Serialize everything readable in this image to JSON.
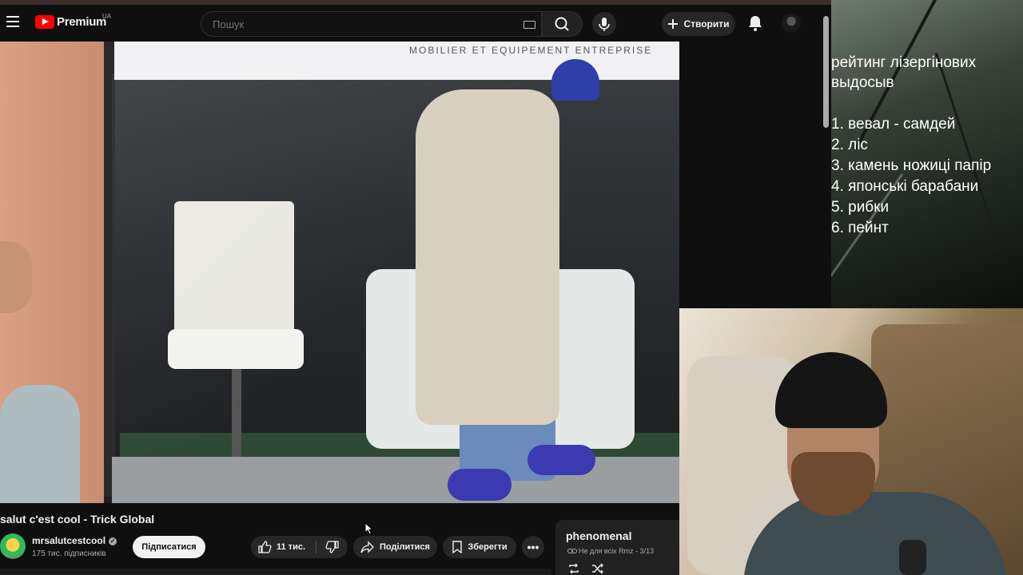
{
  "header": {
    "logo_text": "Premium",
    "logo_region": "UA",
    "search_placeholder": "Пошук",
    "create_label": "Створити",
    "icons": [
      "menu-icon",
      "youtube-logo-icon",
      "keyboard-icon",
      "search-icon",
      "mic-icon",
      "plus-icon",
      "bell-icon"
    ]
  },
  "video": {
    "store_sign": "MOBILIER ET EQUIPEMENT ENTREPRISE"
  },
  "meta": {
    "title": "salut c'est cool - Trick Global",
    "channel_name": "mrsalutcestcool",
    "subscribers": "175 тис. підписників",
    "subscribe_label": "Підписатися",
    "likes": "11 тис.",
    "share_label": "Поділитися",
    "save_label": "Зберегти",
    "more_label": "•••"
  },
  "playlist": {
    "title": "phenomenal",
    "meta": "Не для всіх  Rmz - 3/13"
  },
  "overlay": {
    "heading": "рейтинг лізергінових\nвыдосыв",
    "items": [
      "1. вевал - самдей",
      "2. ліс",
      "3. камень ножиці папір",
      "4. японські барабани",
      "5. рибки",
      "6. пейнт"
    ]
  },
  "colors": {
    "background": "#0f0f0f",
    "youtube_red": "#ff0000",
    "button_bg": "#272727"
  }
}
